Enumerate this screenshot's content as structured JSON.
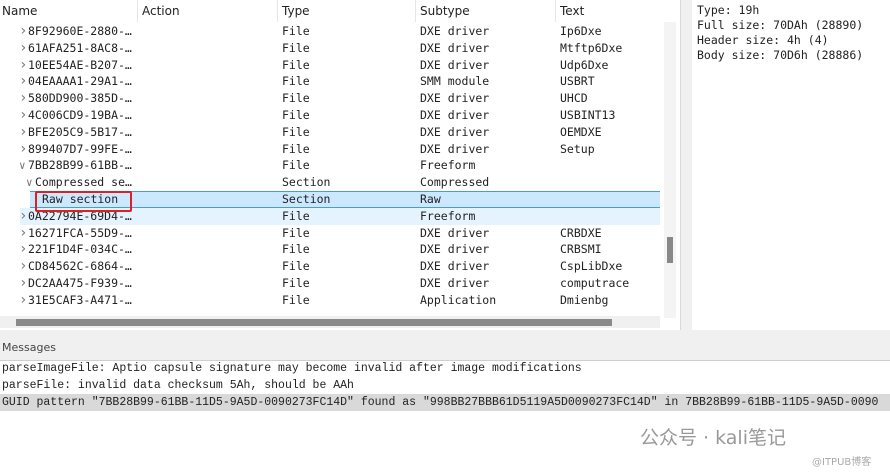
{
  "columns": [
    "Name",
    "Action",
    "Type",
    "Subtype",
    "Text"
  ],
  "rows": [
    {
      "name": "8F92960E-2880-…",
      "type": "File",
      "subtype": "DXE driver",
      "text": "Ip6Dxe",
      "level": 1,
      "chev": ">"
    },
    {
      "name": "61AFA251-8AC8-…",
      "type": "File",
      "subtype": "DXE driver",
      "text": "Mtftp6Dxe",
      "level": 1,
      "chev": ">"
    },
    {
      "name": "10EE54AE-B207-…",
      "type": "File",
      "subtype": "DXE driver",
      "text": "Udp6Dxe",
      "level": 1,
      "chev": ">"
    },
    {
      "name": "04EAAAA1-29A1-…",
      "type": "File",
      "subtype": "SMM module",
      "text": "USBRT",
      "level": 1,
      "chev": ">"
    },
    {
      "name": "580DD900-385D-…",
      "type": "File",
      "subtype": "DXE driver",
      "text": "UHCD",
      "level": 1,
      "chev": ">"
    },
    {
      "name": "4C006CD9-19BA-…",
      "type": "File",
      "subtype": "DXE driver",
      "text": "USBINT13",
      "level": 1,
      "chev": ">"
    },
    {
      "name": "BFE205C9-5B17-…",
      "type": "File",
      "subtype": "DXE driver",
      "text": "OEMDXE",
      "level": 1,
      "chev": ">"
    },
    {
      "name": "899407D7-99FE-…",
      "type": "File",
      "subtype": "DXE driver",
      "text": "Setup",
      "level": 1,
      "chev": ">"
    },
    {
      "name": "7BB28B99-61BB-…",
      "type": "File",
      "subtype": "Freeform",
      "text": "",
      "level": 1,
      "chev": "v"
    },
    {
      "name": "Compressed se…",
      "type": "Section",
      "subtype": "Compressed",
      "text": "",
      "level": 2,
      "chev": "v"
    },
    {
      "name": "Raw section",
      "type": "Section",
      "subtype": "Raw",
      "text": "",
      "level": 3,
      "chev": "",
      "state": "sel"
    },
    {
      "name": "0A22794E-69D4-…",
      "type": "File",
      "subtype": "Freeform",
      "text": "",
      "level": 1,
      "chev": ">",
      "state": "hov"
    },
    {
      "name": "16271FCA-55D9-…",
      "type": "File",
      "subtype": "DXE driver",
      "text": "CRBDXE",
      "level": 1,
      "chev": ">"
    },
    {
      "name": "221F1D4F-034C-…",
      "type": "File",
      "subtype": "DXE driver",
      "text": "CRBSMI",
      "level": 1,
      "chev": ">"
    },
    {
      "name": "CD84562C-6864-…",
      "type": "File",
      "subtype": "DXE driver",
      "text": "CspLibDxe",
      "level": 1,
      "chev": ">"
    },
    {
      "name": "DC2AA475-F939-…",
      "type": "File",
      "subtype": "DXE driver",
      "text": "computrace",
      "level": 1,
      "chev": ">"
    },
    {
      "name": "31E5CAF3-A471-…",
      "type": "File",
      "subtype": "Application",
      "text": "Dmienbg",
      "level": 1,
      "chev": ">"
    }
  ],
  "info": [
    "Type: 19h",
    "Full size: 70DAh (28890)",
    "Header size: 4h (4)",
    "Body size: 70D6h (28886)"
  ],
  "messages_title": "Messages",
  "messages": [
    "parseImageFile: Aptio capsule signature may become invalid after image modifications",
    "parseFile: invalid data checksum 5Ah, should be AAh",
    "GUID pattern \"7BB28B99-61BB-11D5-9A5D-0090273FC14D\" found as \"998BB27BBB61D5119A5D0090273FC14D\" in 7BB28B99-61BB-11D5-9A5D-0090"
  ],
  "watermark": "公众号 · kali笔记",
  "watermark2": "@ITPUB博客"
}
